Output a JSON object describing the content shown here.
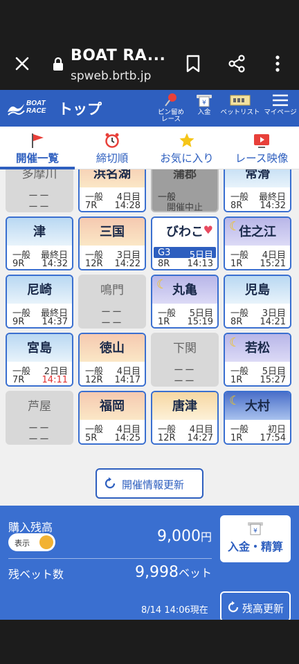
{
  "browser": {
    "title": "BOAT RA...",
    "url": "spweb.brtb.jp"
  },
  "header": {
    "logo_line1": "BOAT",
    "logo_line2": "RACE",
    "title": "トップ",
    "icons": [
      {
        "label": "ピン留め\nレース",
        "icon": "pin-icon"
      },
      {
        "label": "入金",
        "icon": "deposit-icon"
      },
      {
        "label": "ベットリスト",
        "icon": "ticket-icon"
      },
      {
        "label": "マイページ",
        "icon": "menu-icon"
      }
    ]
  },
  "tabs": [
    {
      "label": "開催一覧",
      "icon": "flag-icon",
      "active": true
    },
    {
      "label": "締切順",
      "icon": "alarm-clock-icon",
      "active": false
    },
    {
      "label": "お気に入り",
      "icon": "star-icon",
      "active": false
    },
    {
      "label": "レース映像",
      "icon": "video-icon",
      "active": false
    }
  ],
  "venues": [
    {
      "name": "多摩川",
      "status": "closed",
      "dash1": "ーー",
      "dash2": "ーー"
    },
    {
      "name": "浜名湖",
      "status": "open",
      "theme": "dawn",
      "grade": "一般",
      "day": "4日目",
      "race": "7R",
      "time": "14:28"
    },
    {
      "name": "蒲郡",
      "status": "cancel",
      "grade": "一般",
      "note": "開催中止"
    },
    {
      "name": "常滑",
      "status": "open",
      "theme": "day",
      "grade": "一般",
      "day": "最終日",
      "race": "8R",
      "time": "14:32"
    },
    {
      "name": "津",
      "status": "open",
      "theme": "day",
      "grade": "一般",
      "day": "最終日",
      "race": "9R",
      "time": "14:32"
    },
    {
      "name": "三国",
      "status": "open",
      "theme": "dawn",
      "grade": "一般",
      "day": "3日目",
      "race": "12R",
      "time": "14:22"
    },
    {
      "name": "びわこ",
      "status": "open",
      "theme": "white",
      "grade": "G3",
      "day": "5日目",
      "race": "8R",
      "time": "14:13",
      "highlight": true,
      "favorite": true
    },
    {
      "name": "住之江",
      "status": "open",
      "theme": "night",
      "grade": "一般",
      "day": "4日目",
      "race": "1R",
      "time": "15:21"
    },
    {
      "name": "尼崎",
      "status": "open",
      "theme": "day",
      "grade": "一般",
      "day": "最終日",
      "race": "9R",
      "time": "14:37"
    },
    {
      "name": "鳴門",
      "status": "closed",
      "dash1": "ーー",
      "dash2": "ーー"
    },
    {
      "name": "丸亀",
      "status": "open",
      "theme": "night",
      "grade": "一般",
      "day": "5日目",
      "race": "1R",
      "time": "15:19"
    },
    {
      "name": "児島",
      "status": "open",
      "theme": "day",
      "grade": "一般",
      "day": "3日目",
      "race": "8R",
      "time": "14:21"
    },
    {
      "name": "宮島",
      "status": "open",
      "theme": "day",
      "grade": "一般",
      "day": "2日目",
      "race": "7R",
      "time": "14:11",
      "urgent": true
    },
    {
      "name": "徳山",
      "status": "open",
      "theme": "dawn",
      "grade": "一般",
      "day": "4日目",
      "race": "12R",
      "time": "14:17"
    },
    {
      "name": "下関",
      "status": "closed",
      "dash1": "ーー",
      "dash2": "ーー"
    },
    {
      "name": "若松",
      "status": "open",
      "theme": "night",
      "grade": "一般",
      "day": "5日目",
      "race": "1R",
      "time": "15:27"
    },
    {
      "name": "芦屋",
      "status": "closed",
      "dash1": "ーー",
      "dash2": "ーー"
    },
    {
      "name": "福岡",
      "status": "open",
      "theme": "dawn",
      "grade": "一般",
      "day": "4日目",
      "race": "5R",
      "time": "14:25"
    },
    {
      "name": "唐津",
      "status": "open",
      "theme": "sunrise",
      "grade": "一般",
      "day": "4日目",
      "race": "12R",
      "time": "14:27"
    },
    {
      "name": "大村",
      "status": "open",
      "theme": "stars",
      "grade": "一般",
      "day": "初日",
      "race": "1R",
      "time": "17:54"
    }
  ],
  "refresh_label": "開催情報更新",
  "balance": {
    "label": "購入残高",
    "toggle_label": "表示",
    "amount": "9,000",
    "amount_unit": "円",
    "bet_label": "残ベット数",
    "bet_count": "9,998",
    "bet_unit": "ベット",
    "deposit_label": "入金・精算",
    "as_of": "8/14 14:06現在",
    "refresh_label": "残高更新"
  },
  "colors": {
    "brand": "#2e5fbf",
    "urgent": "#e03030",
    "toggle": "#f2b233"
  }
}
